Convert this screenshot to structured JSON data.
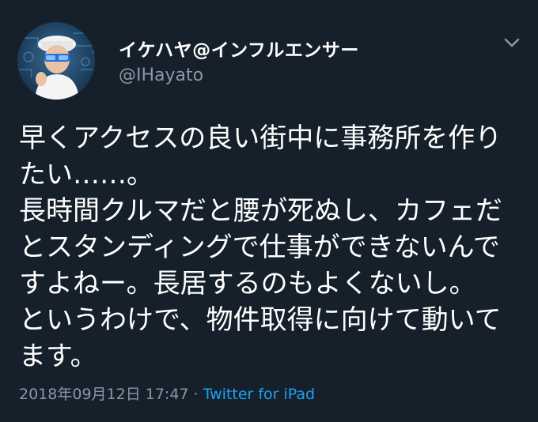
{
  "tweet": {
    "display_name": "イケハヤ@インフルエンサー",
    "handle": "@IHayato",
    "caret_icon": "chevron-down-icon",
    "text_lines": [
      "早くアクセスの良い街中に事務所を作り",
      "たい……。",
      "長時間クルマだと腰が死ぬし、カフェだ",
      "とスタンディングで仕事ができないんで",
      "すよねー。長居するのもよくないし。",
      "というわけで、物件取得に向けて動いて",
      "ます。"
    ],
    "timestamp": "2018年09月12日 17:47",
    "separator": " · ",
    "source": "Twitter for iPad"
  },
  "colors": {
    "background": "#15202b",
    "secondary_text": "#8899a6",
    "link": "#1da1f2"
  }
}
